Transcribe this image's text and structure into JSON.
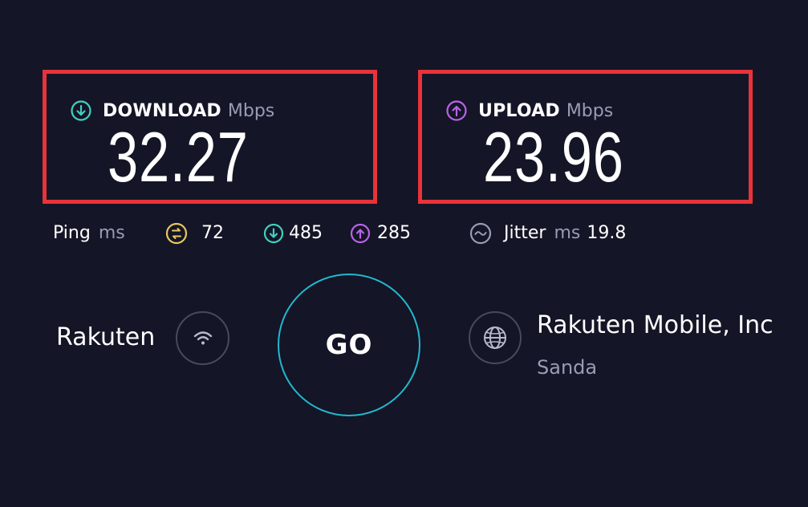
{
  "download": {
    "label": "DOWNLOAD",
    "unit": "Mbps",
    "value": "32.27",
    "icon": "download-arrow-icon",
    "color": "#3fd1c1"
  },
  "upload": {
    "label": "UPLOAD",
    "unit": "Mbps",
    "value": "23.96",
    "icon": "upload-arrow-icon",
    "color": "#b864e8"
  },
  "ping": {
    "label": "Ping",
    "unit": "ms",
    "idle_value": "72",
    "idle_icon": "ping-idle-icon",
    "idle_color": "#e8c860",
    "download_value": "485",
    "upload_value": "285"
  },
  "jitter": {
    "label": "Jitter",
    "unit": "ms",
    "value": "19.8",
    "icon": "jitter-wave-icon"
  },
  "isp": {
    "name": "Rakuten",
    "icon": "wifi-icon"
  },
  "go_button": {
    "label": "GO",
    "border_color": "#22b8cf"
  },
  "server": {
    "name": "Rakuten Mobile, Inc",
    "location": "Sanda",
    "icon": "globe-icon"
  },
  "highlight_color": "#e8333a",
  "background_color": "#141526"
}
